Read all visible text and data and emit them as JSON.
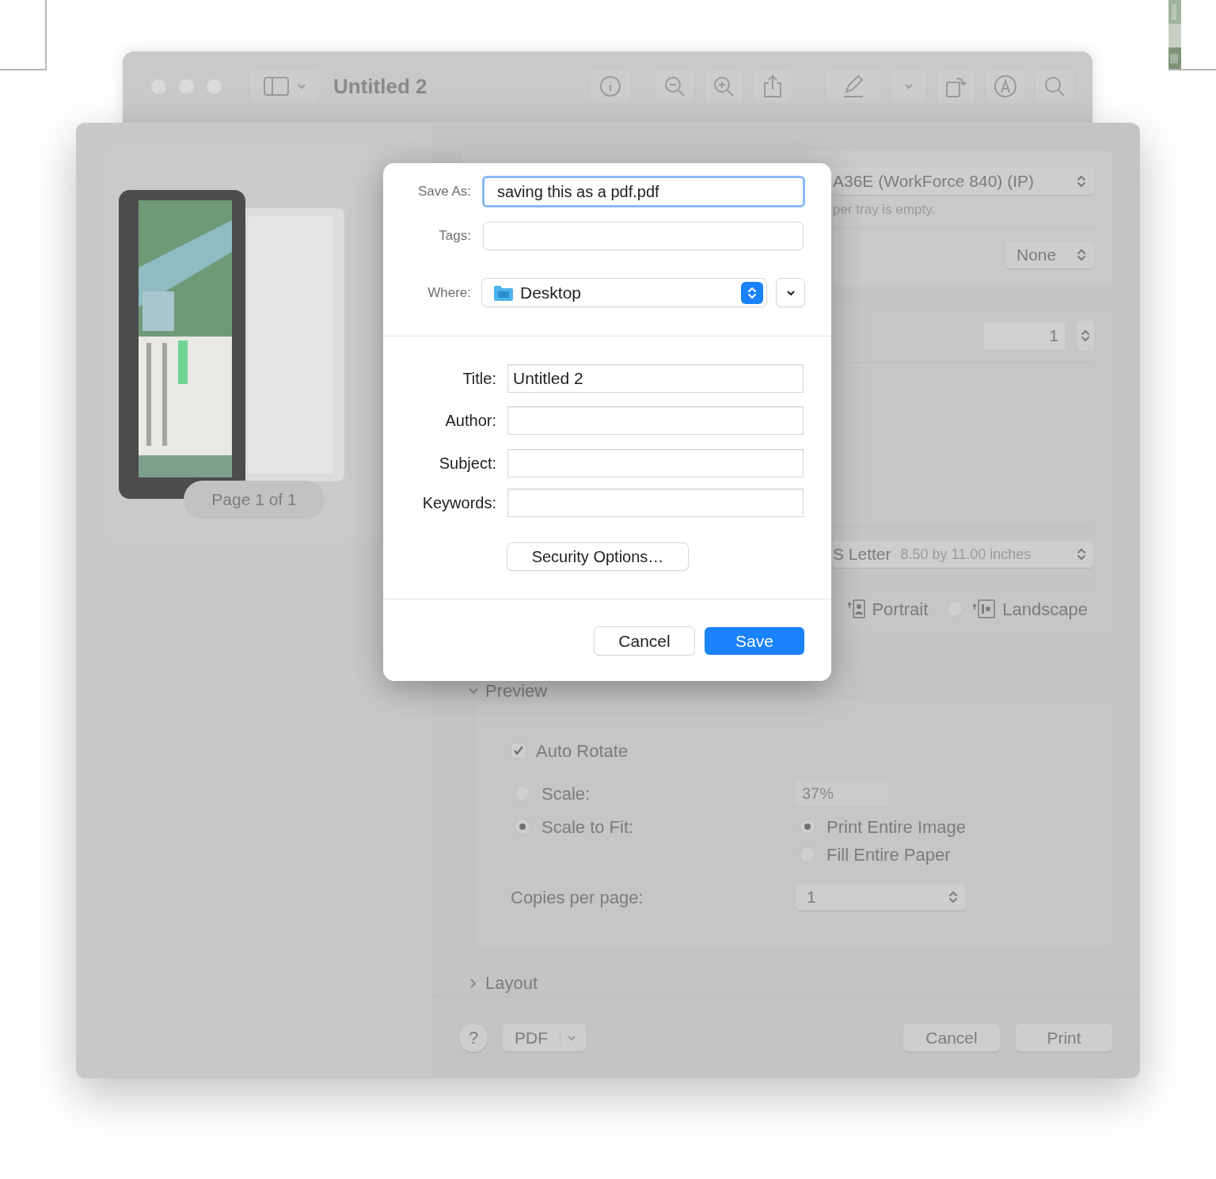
{
  "window": {
    "title": "Untitled 2"
  },
  "print_sheet": {
    "preview": {
      "page_label": "Page 1 of 1"
    },
    "printer": {
      "value": "A36E (WorkForce 840) (IP)",
      "status": "per tray is empty."
    },
    "presets": {
      "value": "None"
    },
    "copies": {
      "value": "1"
    },
    "paper_size": {
      "value": "S Letter",
      "detail": "8.50 by 11.00 inches"
    },
    "orientation": {
      "portrait_label": "Portrait",
      "landscape": {
        "label": "Landscape",
        "selected": false
      }
    },
    "sections": [
      {
        "label": "Preview",
        "expanded": true
      },
      {
        "label": "Layout",
        "expanded": false
      }
    ],
    "auto_rotate": {
      "label": "Auto Rotate",
      "checked": true
    },
    "scale_modes": [
      {
        "label": "Scale:",
        "selected": false
      },
      {
        "label": "Scale to Fit:",
        "selected": true
      }
    ],
    "scale_value": "37%",
    "fit_modes": [
      {
        "label": "Print Entire Image",
        "selected": true
      },
      {
        "label": "Fill Entire Paper",
        "selected": false
      }
    ],
    "copies_per_page": {
      "label": "Copies per page:",
      "value": "1"
    },
    "footer": {
      "help": "?",
      "pdf_menu": "PDF",
      "buttons": [
        "Cancel",
        "Print"
      ]
    }
  },
  "save_dialog": {
    "save_as": {
      "label": "Save As:",
      "value": "saving this as a pdf.pdf"
    },
    "tags": {
      "label": "Tags:"
    },
    "where": {
      "label": "Where:",
      "value": "Desktop"
    },
    "metadata": [
      {
        "label": "Title:",
        "value": "Untitled 2"
      },
      {
        "label": "Author:"
      },
      {
        "label": "Subject:"
      },
      {
        "label": "Keywords:"
      }
    ],
    "security_button": "Security Options…",
    "buttons": [
      {
        "label": "Cancel",
        "kind": "secondary"
      },
      {
        "label": "Save",
        "kind": "default"
      }
    ]
  }
}
